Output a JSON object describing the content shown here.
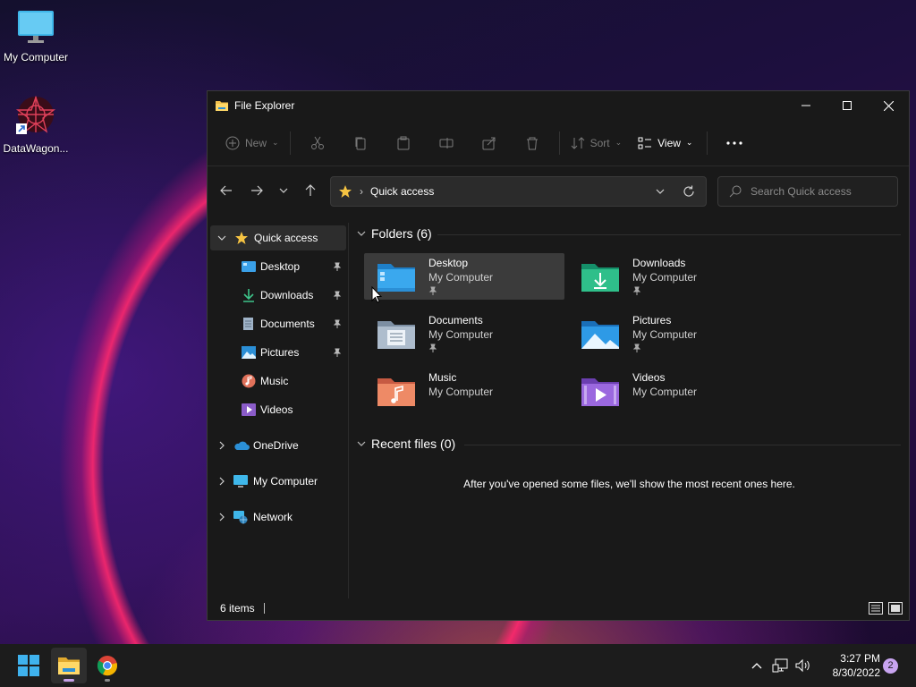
{
  "desktop": {
    "icons": [
      {
        "label": "My Computer"
      },
      {
        "label": "DataWagon..."
      }
    ]
  },
  "window": {
    "title": "File Explorer",
    "toolbar": {
      "new_label": "New",
      "sort_label": "Sort",
      "view_label": "View"
    },
    "address": {
      "crumb": "Quick access"
    },
    "search": {
      "placeholder": "Search Quick access"
    },
    "nav": {
      "quick_access": "Quick access",
      "pinned": [
        {
          "label": "Desktop",
          "pinned": true
        },
        {
          "label": "Downloads",
          "pinned": true
        },
        {
          "label": "Documents",
          "pinned": true
        },
        {
          "label": "Pictures",
          "pinned": true
        },
        {
          "label": "Music",
          "pinned": false
        },
        {
          "label": "Videos",
          "pinned": false
        }
      ],
      "roots": [
        {
          "label": "OneDrive"
        },
        {
          "label": "My Computer"
        },
        {
          "label": "Network"
        }
      ]
    },
    "content": {
      "folders_header": "Folders (6)",
      "folders": [
        {
          "name": "Desktop",
          "location": "My Computer",
          "pinned": true,
          "icon": "desktop-folder-icon"
        },
        {
          "name": "Downloads",
          "location": "My Computer",
          "pinned": true,
          "icon": "downloads-folder-icon"
        },
        {
          "name": "Documents",
          "location": "My Computer",
          "pinned": true,
          "icon": "documents-folder-icon"
        },
        {
          "name": "Pictures",
          "location": "My Computer",
          "pinned": true,
          "icon": "pictures-folder-icon"
        },
        {
          "name": "Music",
          "location": "My Computer",
          "pinned": false,
          "icon": "music-folder-icon"
        },
        {
          "name": "Videos",
          "location": "My Computer",
          "pinned": false,
          "icon": "videos-folder-icon"
        }
      ],
      "recent_header": "Recent files (0)",
      "recent_empty": "After you've opened some files, we'll show the most recent ones here."
    },
    "status": {
      "items": "6 items"
    }
  },
  "taskbar": {
    "time": "3:27 PM",
    "date": "8/30/2022",
    "notifications": "2"
  },
  "colors": {
    "accent": "#c6a1e8",
    "window_bg": "#191919",
    "folder_blue": "#3aa0e8",
    "folder_yellow": "#f2c14e"
  }
}
